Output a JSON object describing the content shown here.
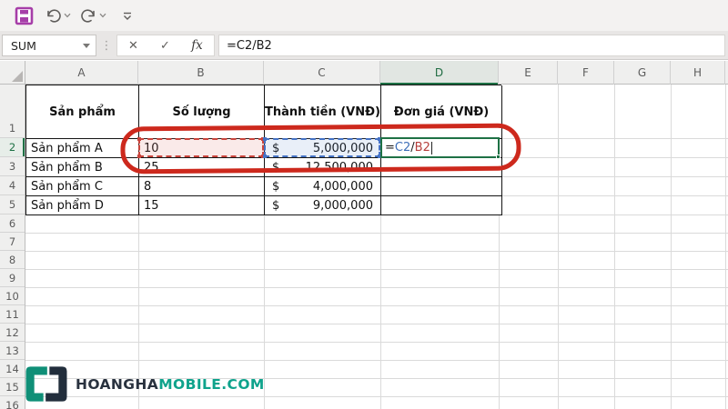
{
  "quick_access_toolbar": {
    "icons": [
      {
        "name": "save"
      },
      {
        "name": "undo"
      },
      {
        "name": "redo"
      },
      {
        "name": "customize-quick-access-toolbar"
      }
    ]
  },
  "formula_bar": {
    "name_box_value": "SUM",
    "cancel_glyph": "✕",
    "enter_glyph": "✓",
    "fx_label": "fx",
    "formula": "=C2/B2"
  },
  "sheet": {
    "column_headers": [
      "A",
      "B",
      "C",
      "D",
      "E",
      "F",
      "G",
      "H"
    ],
    "active_column": "D",
    "row_numbers": [
      "1",
      "2",
      "3",
      "4",
      "5",
      "6",
      "7",
      "8",
      "9",
      "10",
      "11",
      "12",
      "13",
      "14",
      "15",
      "16"
    ],
    "active_row": "2"
  },
  "table": {
    "headers": [
      "Sản phẩm",
      "Số lượng",
      "Thành tiền (VNĐ)",
      "Đơn giá (VNĐ)"
    ],
    "rows": [
      {
        "product": "Sản phẩm A",
        "quantity": "10",
        "currency": "$",
        "amount": "5,000,000"
      },
      {
        "product": "Sản phẩm B",
        "quantity": "25",
        "currency": "$",
        "amount": "12,500,000"
      },
      {
        "product": "Sản phẩm C",
        "quantity": "8",
        "currency": "$",
        "amount": "4,000,000"
      },
      {
        "product": "Sản phẩm D",
        "quantity": "15",
        "currency": "$",
        "amount": "9,000,000"
      }
    ]
  },
  "active_cell": {
    "reference": "D2",
    "parts": [
      {
        "text": "="
      },
      {
        "text": "C2"
      },
      {
        "text": "/"
      },
      {
        "text": "B2"
      }
    ]
  },
  "watermark": {
    "prefix": "HOANGHA",
    "suffix": "MOBILE.COM"
  },
  "colors": {
    "excel_green": "#1e7145",
    "reference_blue": "#3e6fb8",
    "reference_red": "#b63f3c",
    "annotation_red": "#cd291d",
    "save_purple": "#a63ea8",
    "brand_dark": "#29323f",
    "brand_teal": "#0fa38c"
  }
}
